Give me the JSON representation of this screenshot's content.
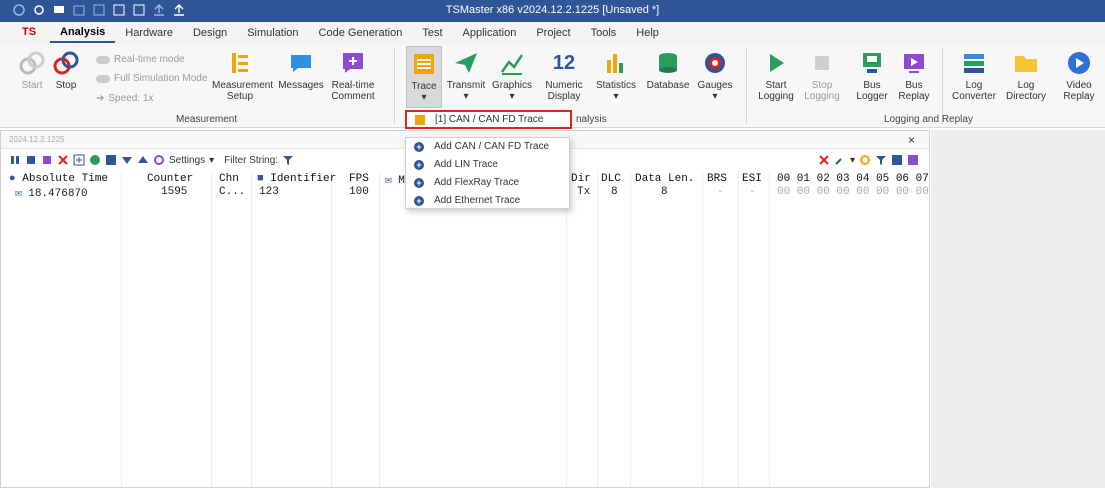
{
  "window": {
    "title": "TSMaster x86 v2024.12.2.1225 [Unsaved *]"
  },
  "menu": {
    "logo": "TS",
    "tabs": [
      "Analysis",
      "Hardware",
      "Design",
      "Simulation",
      "Code Generation",
      "Test",
      "Application",
      "Project",
      "Tools",
      "Help"
    ],
    "active_index": 0
  },
  "ribbon": {
    "start": "Start",
    "stop": "Stop",
    "realtime_mode": "Real-time mode",
    "full_sim_mode": "Full Simulation Mode",
    "speed": "Speed: 1x",
    "measurement_setup": [
      "Measurement",
      "Setup"
    ],
    "messages": "Messages",
    "realtime_comment": [
      "Real-time",
      "Comment"
    ],
    "trace": "Trace",
    "transmit": "Transmit",
    "graphics": "Graphics",
    "numeric_display": [
      "Numeric",
      "Display"
    ],
    "numeric_icon_text": "12",
    "statistics": "Statistics",
    "database": "Database",
    "gauges": "Gauges",
    "start_logging": [
      "Start",
      "Logging"
    ],
    "stop_logging": [
      "Stop",
      "Logging"
    ],
    "bus_logger": [
      "Bus",
      "Logger"
    ],
    "bus_replay": [
      "Bus",
      "Replay"
    ],
    "log_converter": [
      "Log",
      "Converter"
    ],
    "log_directory": [
      "Log",
      "Directory"
    ],
    "video_replay": [
      "Video",
      "Replay"
    ],
    "group_measurement": "Measurement",
    "group_analysis_partial": "nalysis",
    "group_logging": "Logging and Replay"
  },
  "pane": {
    "version": "2024.12.2.1225",
    "close": "×",
    "settings": "Settings",
    "filter": "Filter String:"
  },
  "trace": {
    "headers": {
      "abs_time": "Absolute Time",
      "counter": "Counter",
      "chn": "Chn",
      "identifier": "Identifier",
      "fps": "FPS",
      "m": "M",
      "dir": "Dir",
      "dlc": "DLC",
      "data_len": "Data Len.",
      "brs": "BRS",
      "esi": "ESI",
      "bytes": "00 01 02 03 04 05 06 07"
    },
    "row": {
      "abs_time": "18.476870",
      "counter": "1595",
      "chn": "C...",
      "identifier": "123",
      "fps": "100",
      "dir": "Tx",
      "dlc": "8",
      "data_len": "8",
      "brs": "-",
      "esi": "-",
      "bytes": "00 00 00 00 00 00 00 00"
    }
  },
  "dropdown": {
    "selected": "[1] CAN / CAN FD Trace",
    "items": [
      "Add CAN / CAN FD Trace",
      "Add LIN Trace",
      "Add FlexRay Trace",
      "Add Ethernet Trace"
    ]
  },
  "colors": {
    "title_bg": "#2f5597",
    "highlight_border": "#d22222"
  }
}
